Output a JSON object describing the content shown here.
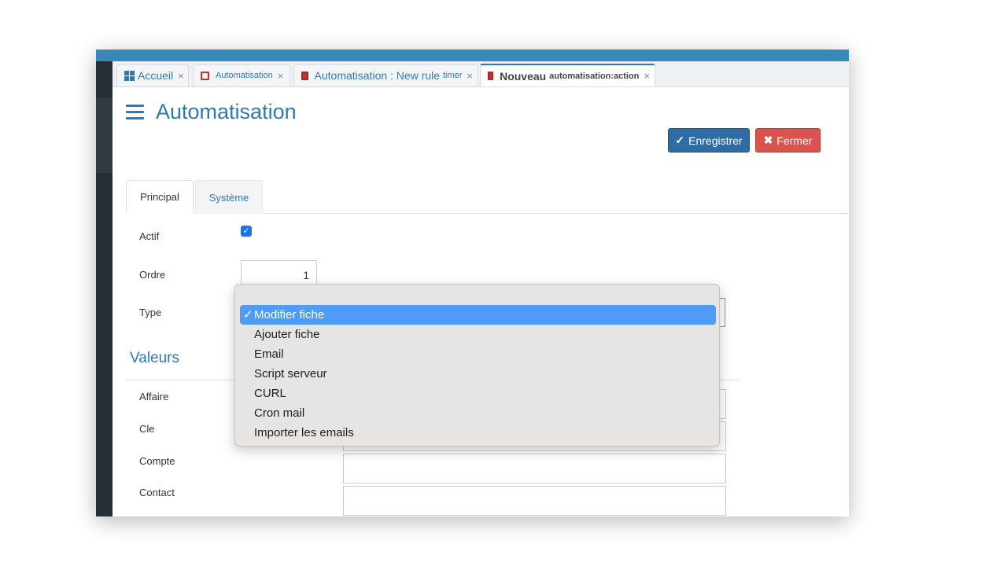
{
  "tabs": [
    {
      "label": "Accueil",
      "small": "",
      "icon": "grid-icon"
    },
    {
      "label": "",
      "small": "Automatisation",
      "icon": "outline-square-icon"
    },
    {
      "label": "Automatisation : New rule",
      "small": "timer",
      "icon": "filled-square-icon"
    },
    {
      "label": "Nouveau",
      "small": "automatisation:action",
      "icon": "filled-square-icon"
    }
  ],
  "tab_close": "×",
  "page_title": "Automatisation",
  "buttons": {
    "save": "Enregistrer",
    "close": "Fermer"
  },
  "form_tabs": [
    "Principal",
    "Système"
  ],
  "fields": {
    "actif": {
      "label": "Actif",
      "checked": true
    },
    "ordre": {
      "label": "Ordre",
      "value": "1"
    },
    "type": {
      "label": "Type",
      "value": "Modifier fiche"
    }
  },
  "section_title": "Valeurs",
  "valeurs": [
    {
      "label": "Affaire",
      "value": ""
    },
    {
      "label": "Cle",
      "value": ""
    },
    {
      "label": "Compte",
      "value": ""
    },
    {
      "label": "Contact",
      "value": ""
    }
  ],
  "type_options": [
    "Modifier fiche",
    "Ajouter fiche",
    "Email",
    "Script serveur",
    "CURL",
    "Cron mail",
    "Importer les emails"
  ],
  "selected_option_index": 0,
  "colors": {
    "accent": "#2e79b4",
    "save_button": "#2e6da4",
    "close_button": "#d9534f",
    "tab_icon": "#c9302c",
    "highlight": "#4f9cf7"
  }
}
